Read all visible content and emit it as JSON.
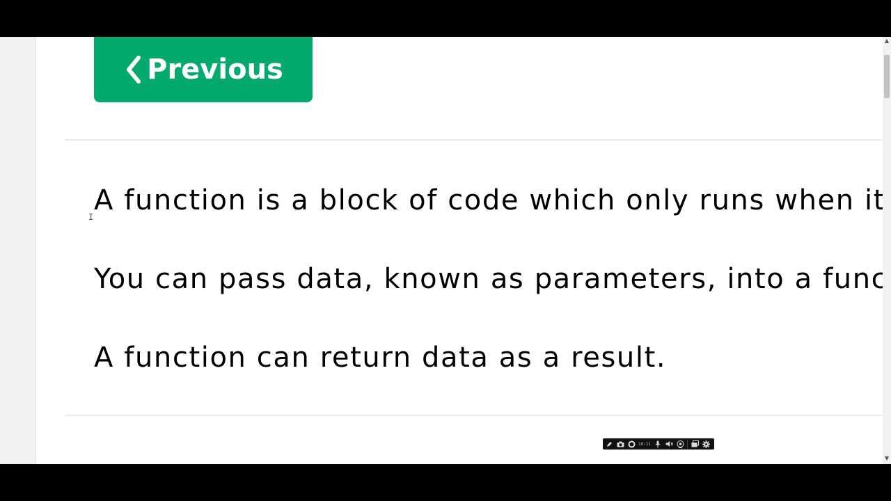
{
  "nav": {
    "previous_label": "Previous"
  },
  "paragraphs": [
    "A function is a block of code which only runs when it i",
    "You can pass data, known as parameters, into a funct",
    "A function can return data as a result."
  ],
  "recorder": {
    "time": "10:11",
    "icons": [
      "pen-icon",
      "camera-icon",
      "record-icon",
      "microphone-icon",
      "speaker-icon",
      "webcam-icon",
      "window-icon",
      "gear-icon"
    ]
  },
  "colors": {
    "accent": "#04aa6d",
    "divider": "#e9ebee",
    "gutter": "#f1f1f1"
  }
}
